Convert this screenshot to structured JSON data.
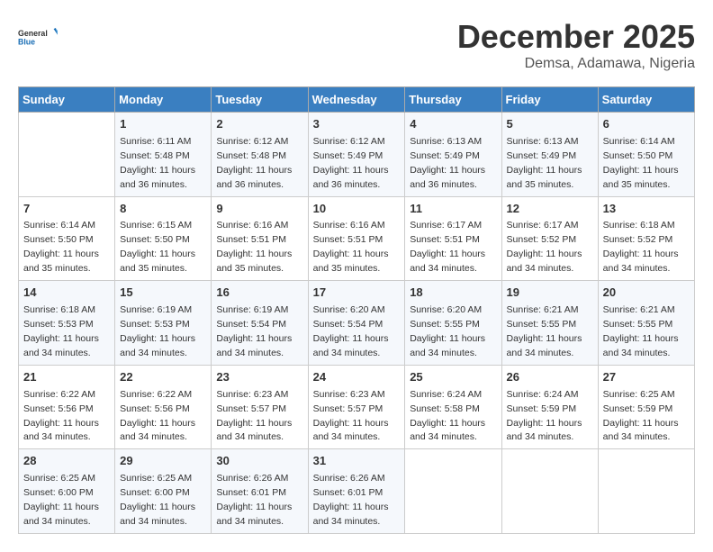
{
  "logo": {
    "line1": "General",
    "line2": "Blue"
  },
  "title": "December 2025",
  "location": "Demsa, Adamawa, Nigeria",
  "headers": [
    "Sunday",
    "Monday",
    "Tuesday",
    "Wednesday",
    "Thursday",
    "Friday",
    "Saturday"
  ],
  "weeks": [
    [
      {
        "day": "",
        "sunrise": "",
        "sunset": "",
        "daylight": ""
      },
      {
        "day": "1",
        "sunrise": "Sunrise: 6:11 AM",
        "sunset": "Sunset: 5:48 PM",
        "daylight": "Daylight: 11 hours and 36 minutes."
      },
      {
        "day": "2",
        "sunrise": "Sunrise: 6:12 AM",
        "sunset": "Sunset: 5:48 PM",
        "daylight": "Daylight: 11 hours and 36 minutes."
      },
      {
        "day": "3",
        "sunrise": "Sunrise: 6:12 AM",
        "sunset": "Sunset: 5:49 PM",
        "daylight": "Daylight: 11 hours and 36 minutes."
      },
      {
        "day": "4",
        "sunrise": "Sunrise: 6:13 AM",
        "sunset": "Sunset: 5:49 PM",
        "daylight": "Daylight: 11 hours and 36 minutes."
      },
      {
        "day": "5",
        "sunrise": "Sunrise: 6:13 AM",
        "sunset": "Sunset: 5:49 PM",
        "daylight": "Daylight: 11 hours and 35 minutes."
      },
      {
        "day": "6",
        "sunrise": "Sunrise: 6:14 AM",
        "sunset": "Sunset: 5:50 PM",
        "daylight": "Daylight: 11 hours and 35 minutes."
      }
    ],
    [
      {
        "day": "7",
        "sunrise": "Sunrise: 6:14 AM",
        "sunset": "Sunset: 5:50 PM",
        "daylight": "Daylight: 11 hours and 35 minutes."
      },
      {
        "day": "8",
        "sunrise": "Sunrise: 6:15 AM",
        "sunset": "Sunset: 5:50 PM",
        "daylight": "Daylight: 11 hours and 35 minutes."
      },
      {
        "day": "9",
        "sunrise": "Sunrise: 6:16 AM",
        "sunset": "Sunset: 5:51 PM",
        "daylight": "Daylight: 11 hours and 35 minutes."
      },
      {
        "day": "10",
        "sunrise": "Sunrise: 6:16 AM",
        "sunset": "Sunset: 5:51 PM",
        "daylight": "Daylight: 11 hours and 35 minutes."
      },
      {
        "day": "11",
        "sunrise": "Sunrise: 6:17 AM",
        "sunset": "Sunset: 5:51 PM",
        "daylight": "Daylight: 11 hours and 34 minutes."
      },
      {
        "day": "12",
        "sunrise": "Sunrise: 6:17 AM",
        "sunset": "Sunset: 5:52 PM",
        "daylight": "Daylight: 11 hours and 34 minutes."
      },
      {
        "day": "13",
        "sunrise": "Sunrise: 6:18 AM",
        "sunset": "Sunset: 5:52 PM",
        "daylight": "Daylight: 11 hours and 34 minutes."
      }
    ],
    [
      {
        "day": "14",
        "sunrise": "Sunrise: 6:18 AM",
        "sunset": "Sunset: 5:53 PM",
        "daylight": "Daylight: 11 hours and 34 minutes."
      },
      {
        "day": "15",
        "sunrise": "Sunrise: 6:19 AM",
        "sunset": "Sunset: 5:53 PM",
        "daylight": "Daylight: 11 hours and 34 minutes."
      },
      {
        "day": "16",
        "sunrise": "Sunrise: 6:19 AM",
        "sunset": "Sunset: 5:54 PM",
        "daylight": "Daylight: 11 hours and 34 minutes."
      },
      {
        "day": "17",
        "sunrise": "Sunrise: 6:20 AM",
        "sunset": "Sunset: 5:54 PM",
        "daylight": "Daylight: 11 hours and 34 minutes."
      },
      {
        "day": "18",
        "sunrise": "Sunrise: 6:20 AM",
        "sunset": "Sunset: 5:55 PM",
        "daylight": "Daylight: 11 hours and 34 minutes."
      },
      {
        "day": "19",
        "sunrise": "Sunrise: 6:21 AM",
        "sunset": "Sunset: 5:55 PM",
        "daylight": "Daylight: 11 hours and 34 minutes."
      },
      {
        "day": "20",
        "sunrise": "Sunrise: 6:21 AM",
        "sunset": "Sunset: 5:55 PM",
        "daylight": "Daylight: 11 hours and 34 minutes."
      }
    ],
    [
      {
        "day": "21",
        "sunrise": "Sunrise: 6:22 AM",
        "sunset": "Sunset: 5:56 PM",
        "daylight": "Daylight: 11 hours and 34 minutes."
      },
      {
        "day": "22",
        "sunrise": "Sunrise: 6:22 AM",
        "sunset": "Sunset: 5:56 PM",
        "daylight": "Daylight: 11 hours and 34 minutes."
      },
      {
        "day": "23",
        "sunrise": "Sunrise: 6:23 AM",
        "sunset": "Sunset: 5:57 PM",
        "daylight": "Daylight: 11 hours and 34 minutes."
      },
      {
        "day": "24",
        "sunrise": "Sunrise: 6:23 AM",
        "sunset": "Sunset: 5:57 PM",
        "daylight": "Daylight: 11 hours and 34 minutes."
      },
      {
        "day": "25",
        "sunrise": "Sunrise: 6:24 AM",
        "sunset": "Sunset: 5:58 PM",
        "daylight": "Daylight: 11 hours and 34 minutes."
      },
      {
        "day": "26",
        "sunrise": "Sunrise: 6:24 AM",
        "sunset": "Sunset: 5:59 PM",
        "daylight": "Daylight: 11 hours and 34 minutes."
      },
      {
        "day": "27",
        "sunrise": "Sunrise: 6:25 AM",
        "sunset": "Sunset: 5:59 PM",
        "daylight": "Daylight: 11 hours and 34 minutes."
      }
    ],
    [
      {
        "day": "28",
        "sunrise": "Sunrise: 6:25 AM",
        "sunset": "Sunset: 6:00 PM",
        "daylight": "Daylight: 11 hours and 34 minutes."
      },
      {
        "day": "29",
        "sunrise": "Sunrise: 6:25 AM",
        "sunset": "Sunset: 6:00 PM",
        "daylight": "Daylight: 11 hours and 34 minutes."
      },
      {
        "day": "30",
        "sunrise": "Sunrise: 6:26 AM",
        "sunset": "Sunset: 6:01 PM",
        "daylight": "Daylight: 11 hours and 34 minutes."
      },
      {
        "day": "31",
        "sunrise": "Sunrise: 6:26 AM",
        "sunset": "Sunset: 6:01 PM",
        "daylight": "Daylight: 11 hours and 34 minutes."
      },
      {
        "day": "",
        "sunrise": "",
        "sunset": "",
        "daylight": ""
      },
      {
        "day": "",
        "sunrise": "",
        "sunset": "",
        "daylight": ""
      },
      {
        "day": "",
        "sunrise": "",
        "sunset": "",
        "daylight": ""
      }
    ]
  ]
}
